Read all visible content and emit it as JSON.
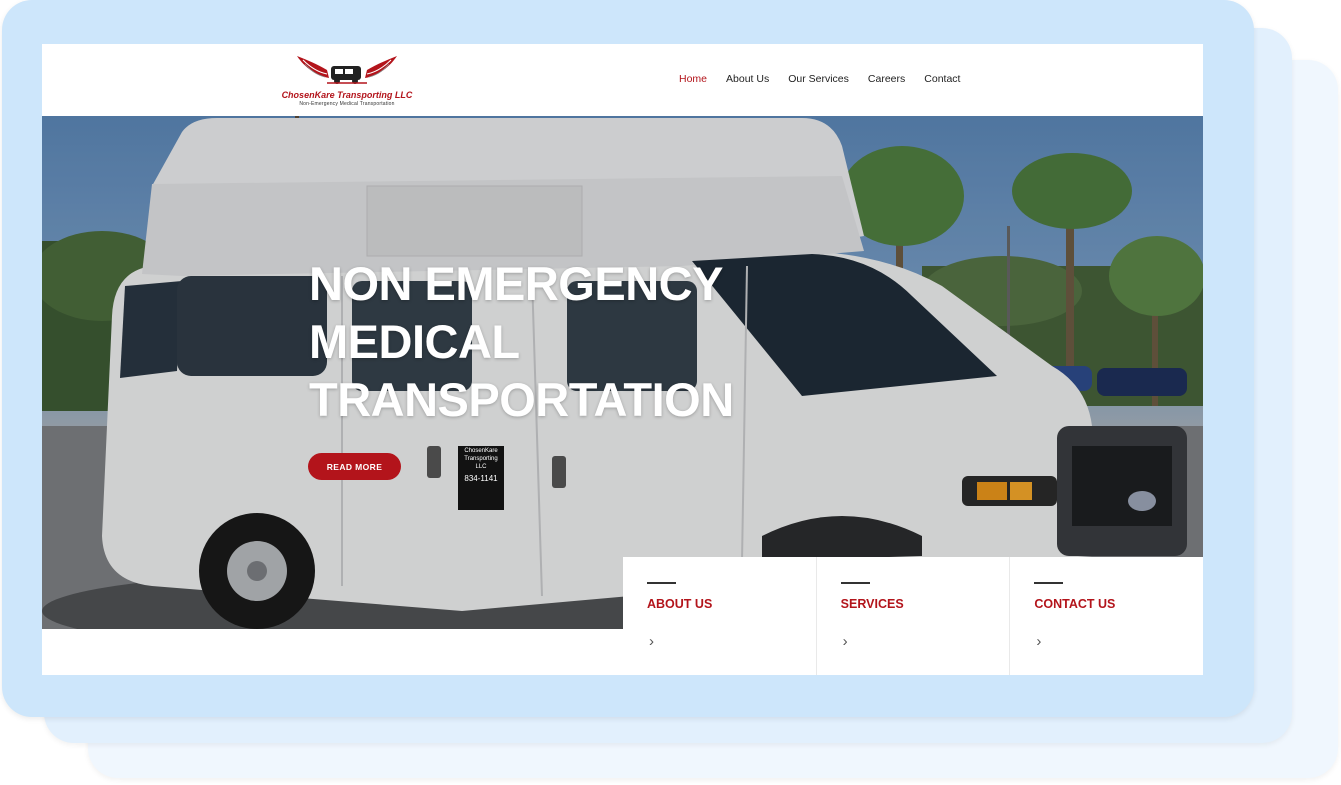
{
  "brand": {
    "name": "ChosenKare Transporting LLC",
    "tagline": "Non-Emergency Medical Transportation",
    "color": "#b3141b"
  },
  "nav": {
    "items": [
      {
        "label": "Home",
        "active": true
      },
      {
        "label": "About Us",
        "active": false
      },
      {
        "label": "Our Services",
        "active": false
      },
      {
        "label": "Careers",
        "active": false
      },
      {
        "label": "Contact",
        "active": false
      }
    ]
  },
  "hero": {
    "title_line1": "NON EMERGENCY",
    "title_line2": "MEDICAL",
    "title_line3": "TRANSPORTATION",
    "cta_label": "READ MORE",
    "van_decal_line1": "ChosenKare",
    "van_decal_line2": "Transporting",
    "van_decal_line3": "LLC",
    "van_decal_phone": "834-1141"
  },
  "cards": [
    {
      "title": "ABOUT US",
      "arrow": "›"
    },
    {
      "title": "SERVICES",
      "arrow": "›"
    },
    {
      "title": "CONTACT US",
      "arrow": "›"
    }
  ]
}
